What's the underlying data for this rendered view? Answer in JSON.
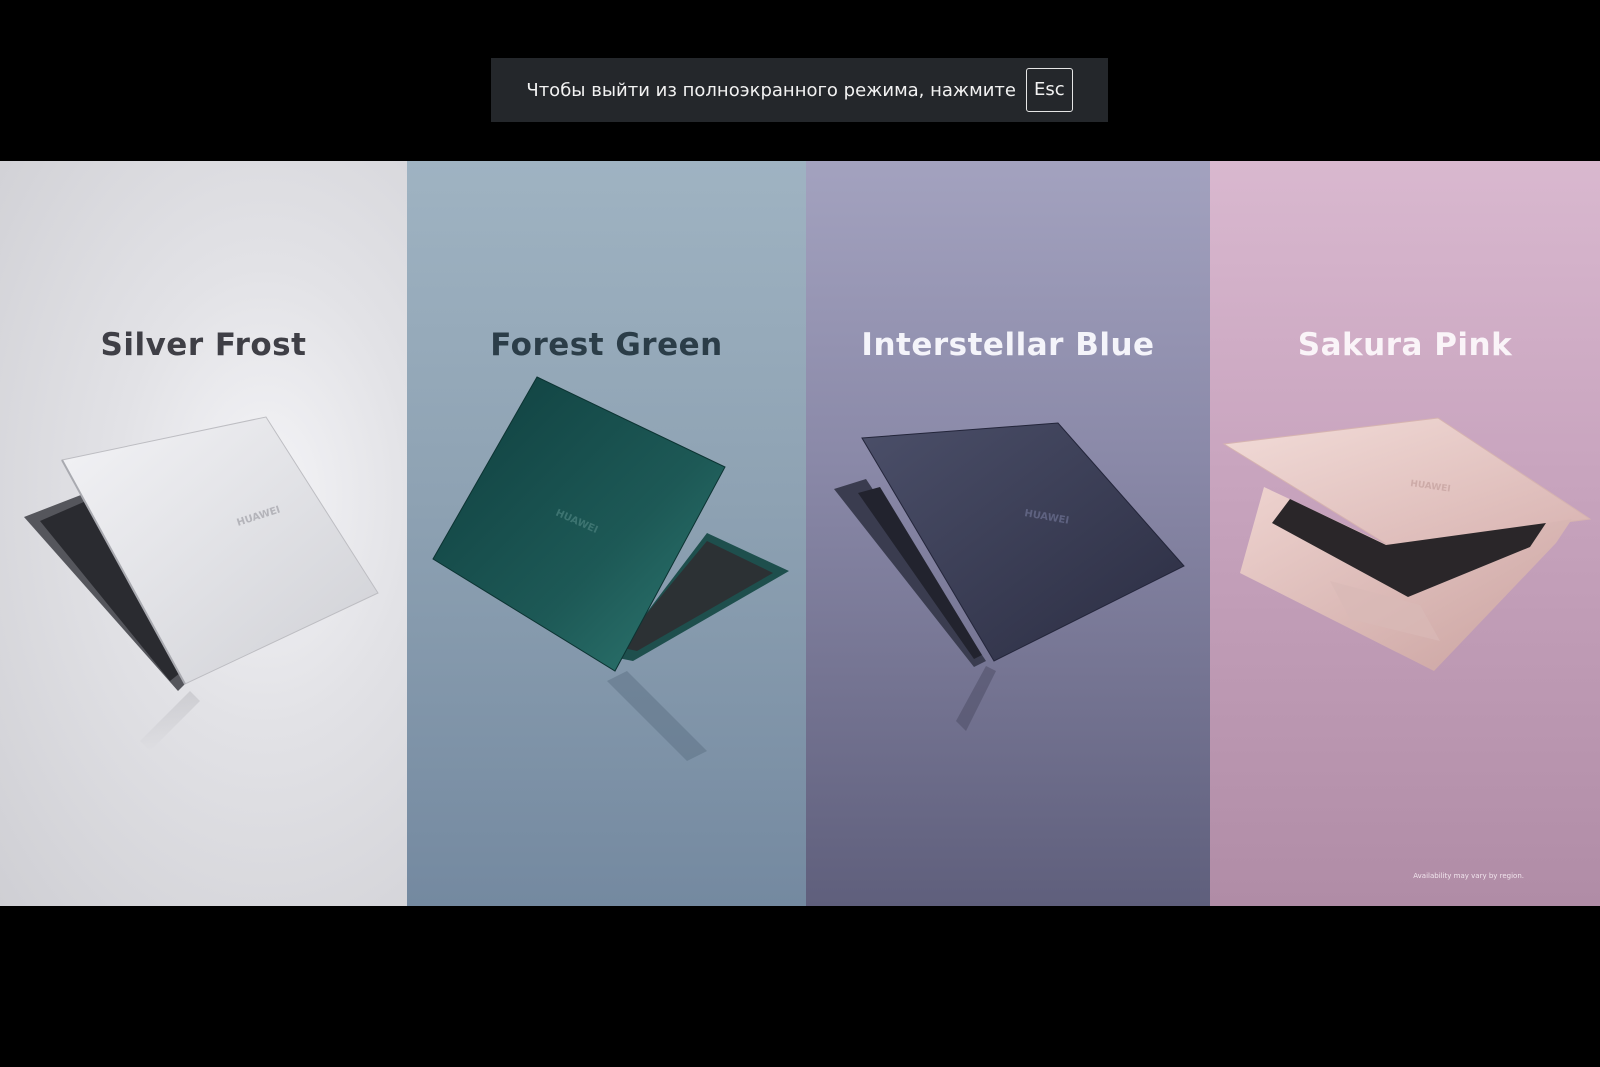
{
  "fullscreen_notice": {
    "message": "Чтобы выйти из полноэкранного режима, нажмите",
    "key": "Esc"
  },
  "panels": [
    {
      "title": "Silver Frost",
      "brand": "HUAWEI"
    },
    {
      "title": "Forest Green",
      "brand": "HUAWEI"
    },
    {
      "title": "Interstellar Blue",
      "brand": "HUAWEI"
    },
    {
      "title": "Sakura Pink",
      "brand": "HUAWEI"
    }
  ],
  "disclaimer": "Availability may vary by region.",
  "colors": {
    "silver_frost": "#d8d8dc",
    "forest_green": "#1f5a57",
    "interstellar_blue": "#3a3d55",
    "sakura_pink": "#e6c2c0"
  }
}
